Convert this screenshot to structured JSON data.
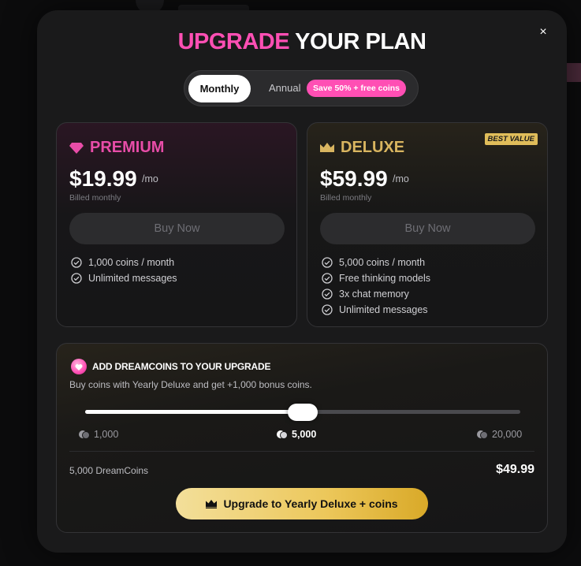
{
  "modal": {
    "title_accent": "UPGRADE",
    "title_rest": " YOUR PLAN",
    "close_glyph": "×"
  },
  "billing_toggle": {
    "monthly_label": "Monthly",
    "annual_label": "Annual",
    "annual_badge": "Save 50% + free coins",
    "selected": "Monthly"
  },
  "plans": [
    {
      "name": "PREMIUM",
      "icon": "gem-icon",
      "price": "$19.99",
      "period": "/mo",
      "billing_note": "Billed monthly",
      "button_label": "Buy Now",
      "features": [
        "1,000 coins / month",
        "Unlimited messages"
      ]
    },
    {
      "name": "DELUXE",
      "icon": "crown-icon",
      "badge": "BEST VALUE",
      "price": "$59.99",
      "period": "/mo",
      "billing_note": "Billed monthly",
      "button_label": "Buy Now",
      "features": [
        "5,000 coins / month",
        "Free thinking models",
        "3x chat memory",
        "Unlimited messages"
      ]
    }
  ],
  "addon": {
    "heading": "ADD DREAMCOINS TO YOUR UPGRADE",
    "subtext": "Buy coins with Yearly Deluxe and get +1,000 bonus coins.",
    "slider": {
      "options": [
        "1,000",
        "5,000",
        "20,000"
      ],
      "selected": "5,000",
      "fill_fraction": 0.5
    },
    "summary_label": "5,000 DreamCoins",
    "summary_price": "$49.99",
    "cta_label": "Upgrade to Yearly Deluxe + coins"
  },
  "colors": {
    "accent_pink": "#ff4fb4",
    "accent_gold": "#d9b560",
    "modal_bg": "#1a1a1b"
  }
}
